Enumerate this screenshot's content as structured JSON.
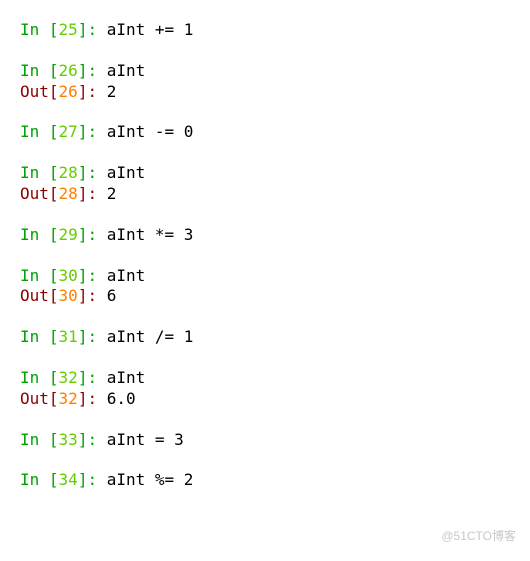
{
  "cells": [
    {
      "type": "in",
      "num": "25",
      "code": "aInt += 1"
    },
    {
      "type": "in",
      "num": "26",
      "code": "aInt"
    },
    {
      "type": "out",
      "num": "26",
      "value": "2"
    },
    {
      "type": "in",
      "num": "27",
      "code": "aInt -= 0"
    },
    {
      "type": "in",
      "num": "28",
      "code": "aInt"
    },
    {
      "type": "out",
      "num": "28",
      "value": "2"
    },
    {
      "type": "in",
      "num": "29",
      "code": "aInt *= 3"
    },
    {
      "type": "in",
      "num": "30",
      "code": "aInt"
    },
    {
      "type": "out",
      "num": "30",
      "value": "6"
    },
    {
      "type": "in",
      "num": "31",
      "code": "aInt /= 1"
    },
    {
      "type": "in",
      "num": "32",
      "code": "aInt"
    },
    {
      "type": "out",
      "num": "32",
      "value": "6.0"
    },
    {
      "type": "in",
      "num": "33",
      "code": "aInt = 3"
    },
    {
      "type": "in",
      "num": "34",
      "code": "aInt %= 2"
    }
  ],
  "labels": {
    "in": "In ",
    "out": "Out"
  },
  "watermark": "@51CTO博客"
}
